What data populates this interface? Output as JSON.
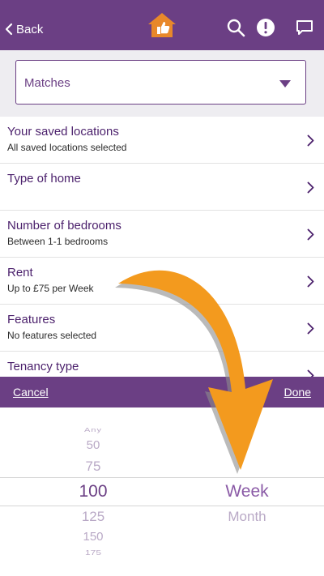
{
  "header": {
    "back_label": "Back",
    "icons": [
      "home-thumbs-up-icon",
      "search-icon",
      "alert-icon",
      "chat-icon"
    ]
  },
  "filter": {
    "selected": "Matches"
  },
  "criteria": [
    {
      "title": "Your saved locations",
      "subtitle": "All saved locations selected"
    },
    {
      "title": "Type of home",
      "subtitle": ""
    },
    {
      "title": "Number of bedrooms",
      "subtitle": "Between 1-1 bedrooms"
    },
    {
      "title": "Rent",
      "subtitle": "Up to £75 per Week"
    },
    {
      "title": "Features",
      "subtitle": "No features selected"
    },
    {
      "title": "Tenancy type",
      "subtitle": ""
    }
  ],
  "picker": {
    "cancel_label": "Cancel",
    "done_label": "Done",
    "amount_options": [
      "Any",
      "50",
      "75",
      "100",
      "125",
      "150",
      "175"
    ],
    "amount_selected": "100",
    "period_options": [
      "Week",
      "Month"
    ],
    "period_selected": "Week"
  },
  "colors": {
    "brand_purple": "#6b3f84",
    "title_purple": "#4a1f6b",
    "logo_orange": "#e8882a",
    "arrow_orange": "#f39a1e",
    "list_background": "#eeedf1"
  }
}
